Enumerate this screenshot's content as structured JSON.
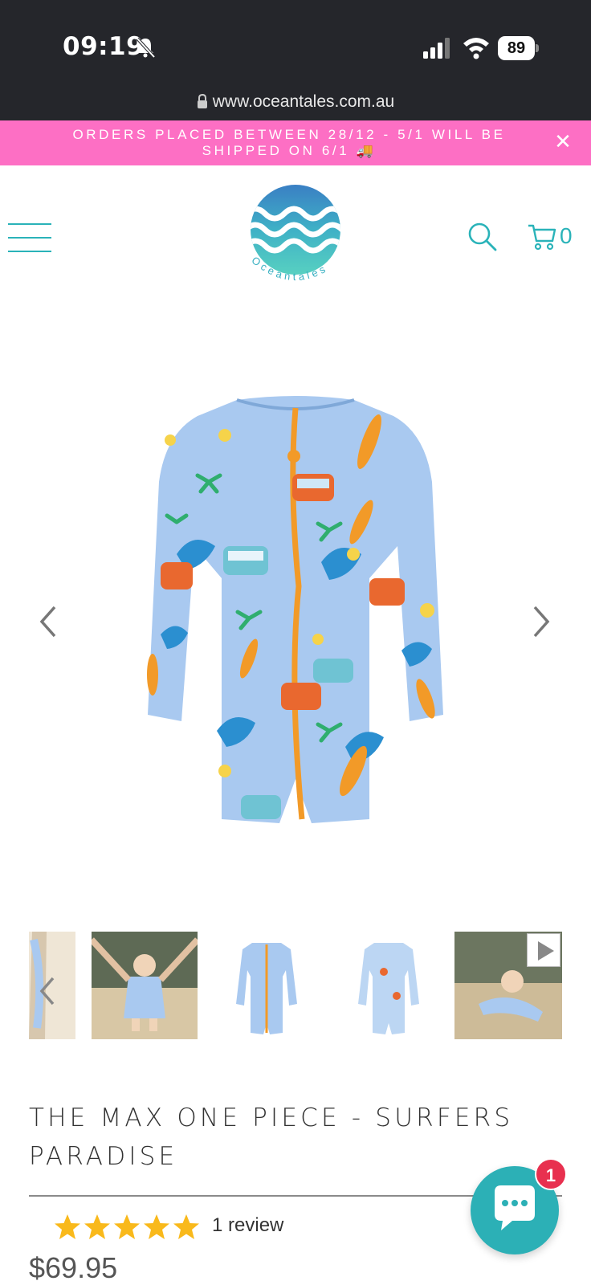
{
  "status_bar": {
    "time": "09:19",
    "battery": "89",
    "url": "www.oceantales.com.au"
  },
  "announcement": {
    "text": "ORDERS PLACED BETWEEN 28/12 - 5/1 WILL BE SHIPPED ON 6/1 🚚",
    "close": "✕",
    "background": "#fd6fc4"
  },
  "header": {
    "logo_text": "Oceantales",
    "cart_count": "0",
    "accent": "#2ab3b9"
  },
  "product": {
    "title": "THE MAX ONE PIECE - SURFERS PARADISE",
    "rating": 5,
    "rating_max": 5,
    "reviews": "1 review",
    "price": "$69.95"
  },
  "gallery": {
    "thumbnails": [
      "side-view",
      "baby-walking-beach",
      "front-flat",
      "back-flat",
      "baby-crawling-video"
    ]
  },
  "chat": {
    "badge": "1",
    "color": "#2cb0b6"
  }
}
